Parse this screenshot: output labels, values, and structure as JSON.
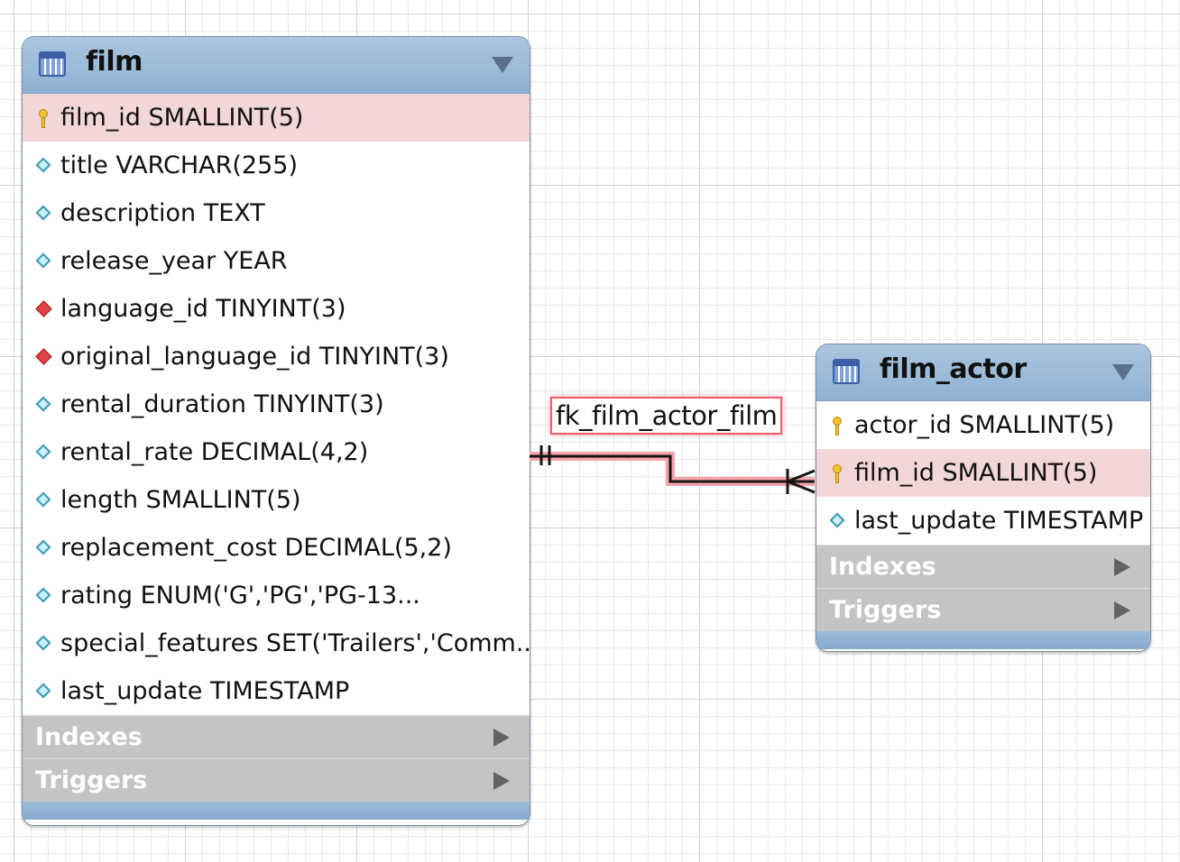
{
  "tables": {
    "film": {
      "name": "film",
      "columns": [
        {
          "text": "film_id SMALLINT(5)",
          "icon": "primary-key-icon"
        },
        {
          "text": "title VARCHAR(255)",
          "icon": "column-icon"
        },
        {
          "text": "description TEXT",
          "icon": "column-icon"
        },
        {
          "text": "release_year YEAR",
          "icon": "column-icon"
        },
        {
          "text": "language_id TINYINT(3)",
          "icon": "foreign-key-icon"
        },
        {
          "text": "original_language_id TINYINT(3)",
          "icon": "foreign-key-icon"
        },
        {
          "text": "rental_duration TINYINT(3)",
          "icon": "column-icon"
        },
        {
          "text": "rental_rate DECIMAL(4,2)",
          "icon": "column-icon"
        },
        {
          "text": "length SMALLINT(5)",
          "icon": "column-icon"
        },
        {
          "text": "replacement_cost DECIMAL(5,2)",
          "icon": "column-icon"
        },
        {
          "text": "rating ENUM('G','PG','PG-13...",
          "icon": "column-icon"
        },
        {
          "text": "special_features SET('Trailers','Comm...",
          "icon": "column-icon"
        },
        {
          "text": "last_update TIMESTAMP",
          "icon": "column-icon"
        }
      ],
      "indexes_label": "Indexes",
      "triggers_label": "Triggers"
    },
    "film_actor": {
      "name": "film_actor",
      "columns": [
        {
          "text": "actor_id SMALLINT(5)",
          "icon": "primary-key-icon"
        },
        {
          "text": "film_id SMALLINT(5)",
          "icon": "primary-key-icon"
        },
        {
          "text": "last_update TIMESTAMP",
          "icon": "column-icon"
        }
      ],
      "indexes_label": "Indexes",
      "triggers_label": "Triggers"
    }
  },
  "relationship": {
    "label": "fk_film_actor_film",
    "from": "film.film_id",
    "to": "film_actor.film_id",
    "cardinality": "one-to-many",
    "highlight_color": "#ef5b6f"
  },
  "colors": {
    "header": "#9ab9d8",
    "highlight_row": "#f2d6d8",
    "section": "#c4c4c4"
  }
}
